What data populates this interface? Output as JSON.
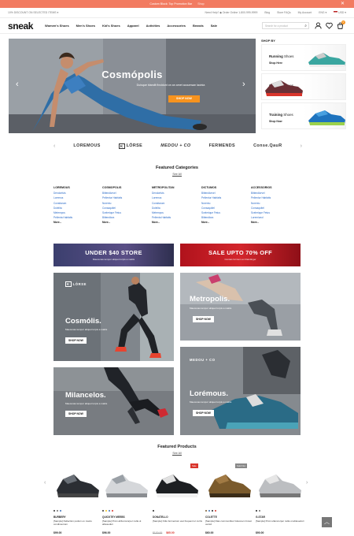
{
  "promo_bar": {
    "text": "Custom Block: Top Promotion Bar",
    "link": "Shop",
    "close": "✕"
  },
  "top_bar": {
    "discount": "10% DISCOUNT ON SELECTED ITEMS",
    "help": "Need Help? ◆ Order Online 1-800-999-9999",
    "links": [
      "Blog",
      "Store FAQs",
      "My Account"
    ],
    "language": "ENG",
    "currency": "USD"
  },
  "nav": {
    "logo": "sneak",
    "menu": [
      "Women's Shoes",
      "Men's Shoes",
      "Kid's Shoes",
      "Apparel",
      "Activities",
      "Accessories",
      "Brands",
      "Sale"
    ],
    "search_placeholder": "Search for a product",
    "cart_count": "0"
  },
  "hero": {
    "title": "Cosmópolis",
    "subtitle": "Duisque blandit fincidunt on an amet accumsan lacinia",
    "button": "SHOP NOW"
  },
  "shop_by": {
    "heading": "SHOP BY",
    "items": [
      {
        "bold": "Running",
        "rest": " Shoes",
        "link": "Shop Here"
      },
      {
        "bold": "Outdoor",
        "rest": " Shoes",
        "link": "Shop Now"
      },
      {
        "bold": "Training",
        "rest": " Shoes",
        "link": "Shop Now"
      }
    ]
  },
  "brands": [
    "LOREMOUS",
    "LÓRSE",
    "MEDOU + CO",
    "FERMENDS",
    "Conse.QauR"
  ],
  "featured_categories": {
    "title": "Featured Categories",
    "see_all": "See All",
    "columns": [
      {
        "heading": "LOREMOUS",
        "items": [
          "Dendorfuts",
          "Loremus",
          "Consitarum",
          "Dolelita",
          "Metempos",
          "Pellenta Habfatis"
        ],
        "more": "More..."
      },
      {
        "heading": "COSMOPOLIS",
        "items": [
          "Bittendlorvel",
          "Pellentur Habfatis",
          "Norentu",
          "Consaquitel",
          "Scelerique Fetus",
          "Bittendlora"
        ],
        "more": "More..."
      },
      {
        "heading": "METROPOLITAN",
        "items": [
          "Dendorfuts",
          "Loremus",
          "Consitarum",
          "Dolelita",
          "Metempos",
          "Pellenta Habfatis"
        ],
        "more": "More..."
      },
      {
        "heading": "DICTUMOS",
        "items": [
          "Bittendlorvel",
          "Pellentur Habfatis",
          "Norentu",
          "Consaquitel",
          "Scelerique Fetus",
          "Bittendlora"
        ],
        "more": "More..."
      },
      {
        "heading": "ACCESSORIOS",
        "items": [
          "Bittendlorvel",
          "Pellentur Habfatis",
          "Norentu",
          "Consaquitel",
          "Scelerique Fetus",
          "Loremiunol"
        ],
        "more": "More..."
      }
    ]
  },
  "banners": [
    {
      "title": "UNDER $40 STORE",
      "subtitle": "Maecenas tempor aliquet turpis a mattis"
    },
    {
      "title": "SALE UPTO 70% OFF",
      "subtitle": "Conteis fermum ex blandinger"
    }
  ],
  "tiles": [
    {
      "brand": "LÓRSE",
      "title": "Cosmólis.",
      "subtitle": "Maecenas tempor aliquet turpis a mattis",
      "button": "SHOP NOW"
    },
    {
      "brand": "",
      "title": "Metropolis.",
      "subtitle": "Maecenas tempor aliquet turpis a mattis",
      "button": "SHOP NOW"
    },
    {
      "brand": "",
      "title": "Milancelos.",
      "subtitle": "Maecenas tempor aliquet turpis a mattis",
      "button": "SHOP NOW"
    },
    {
      "brand": "MEDOU + CO",
      "title": "Lorémous.",
      "subtitle": "Maecenas tempor aliquet turpis a mattis",
      "button": "SHOP NOW"
    }
  ],
  "featured_products": {
    "title": "Featured Products",
    "see_all": "See All",
    "items": [
      {
        "name": "BURBERY",
        "desc": "[Sample] Dellection podum ex maxto condimentum",
        "price": "$99.00",
        "old_price": "",
        "badge": "",
        "colors": [
          "#333333",
          "#6e6e6e",
          "#3a6fb8"
        ]
      },
      {
        "name": "QUICKTEY MEEBS",
        "desc": "[Sample] Proin abfusmcorper nulla ut ableseduri",
        "price": "$96.00",
        "old_price": "",
        "badge": "",
        "colors": [
          "#333333",
          "#f0c419",
          "#3a6fb8",
          "#d9342b"
        ]
      },
      {
        "name": "DONATELLO",
        "desc": "[Sample] Odio fermentum eiet frequent ul curris",
        "price": "$65.00",
        "old_price": "$120.00",
        "badge": "Sale",
        "colors": [
          "#222222"
        ]
      },
      {
        "name": "COLETTE",
        "desc": "[Sample] Dias communtikor fokusnem furest ouinid",
        "price": "$60.00",
        "old_price": "",
        "badge": "Sold Out",
        "colors": [
          "#7a5a2c",
          "#3a6fb8",
          "#222222",
          "#d9342b"
        ]
      },
      {
        "name": "G-STAR",
        "desc": "[Sample] Proin ullamcorper nulla ut ableseduri",
        "price": "$90.00",
        "old_price": "",
        "badge": "",
        "colors": [
          "#222222",
          "#6e6e6e"
        ]
      }
    ]
  }
}
